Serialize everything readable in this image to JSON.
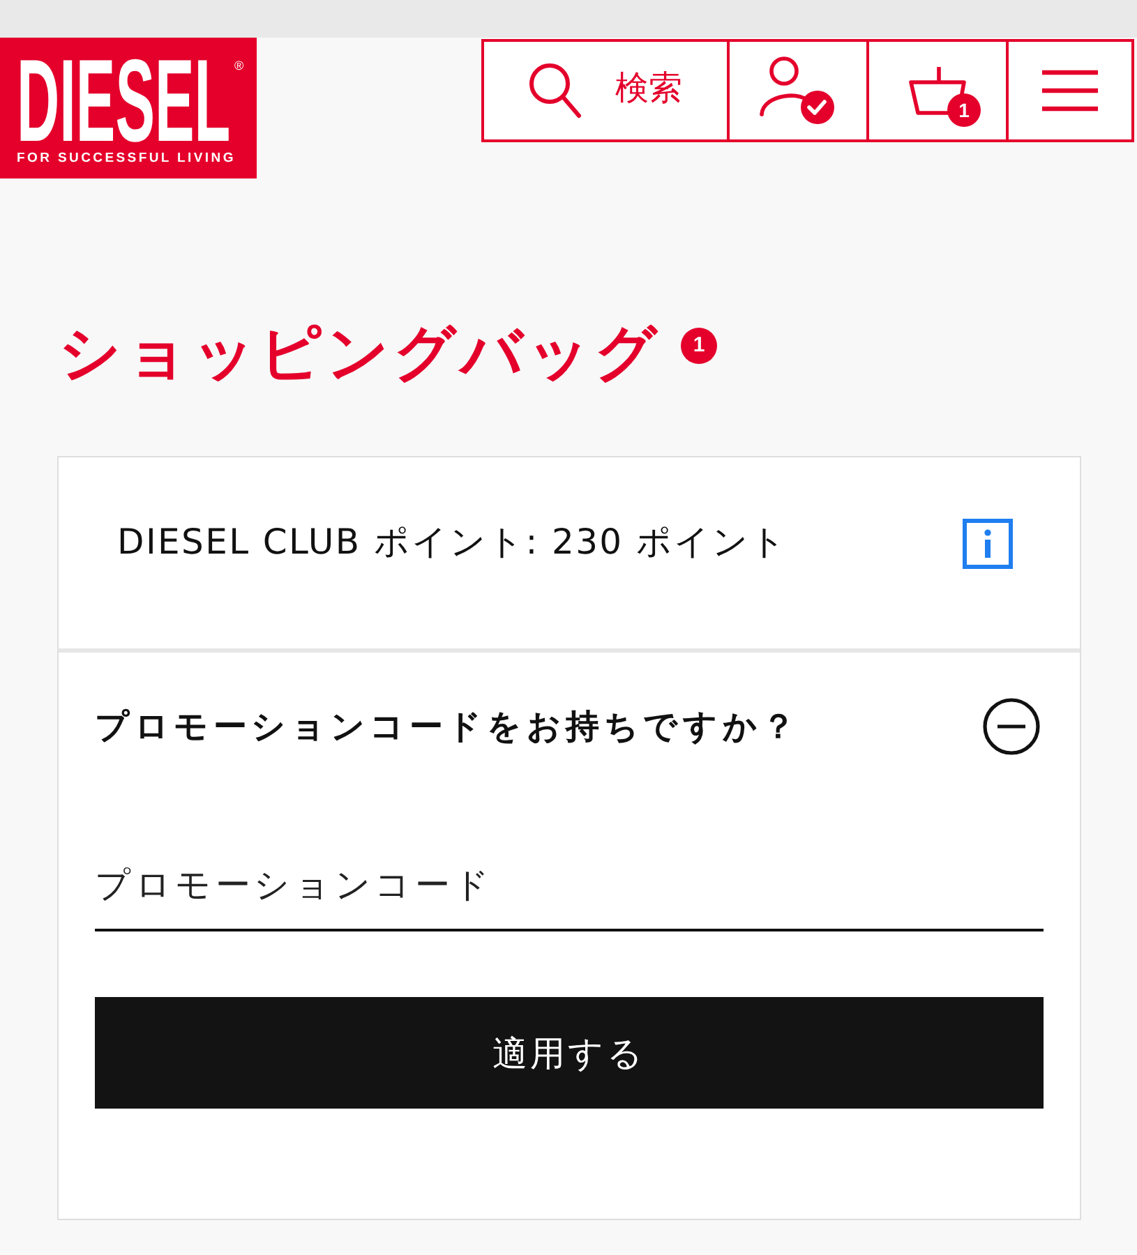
{
  "header": {
    "logo": {
      "wordmark": "DIESEL",
      "registered_mark": "®",
      "tagline": "FOR SUCCESSFUL LIVING"
    },
    "nav": [
      {
        "kind": "search",
        "label": "検索"
      },
      {
        "kind": "account"
      },
      {
        "kind": "cart",
        "badge": "1"
      },
      {
        "kind": "menu"
      }
    ]
  },
  "page_title": {
    "text": "ショッピングバッグ",
    "badge": "1"
  },
  "points": {
    "text": "DIESEL CLUB ポイント: 230 ポイント"
  },
  "promo": {
    "heading": "プロモーションコードをお持ちですか？",
    "expanded": true,
    "field": {
      "placeholder": "プロモーションコード"
    },
    "button": "適用する"
  }
}
